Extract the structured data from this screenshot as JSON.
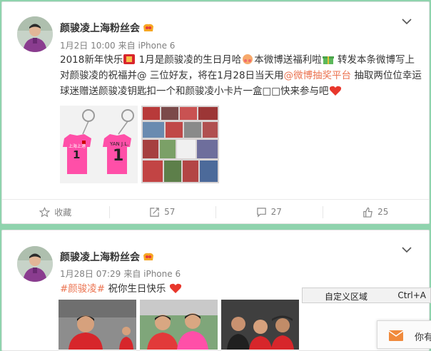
{
  "posts": [
    {
      "author": "颜骏凌上海粉丝会",
      "time": "1月2日 10:00",
      "source": "来自 iPhone 6",
      "text": {
        "p1": "2018新年快乐",
        "p2": " 1月是颜骏凌的生日月哈",
        "p3": "本微博送福利啦",
        "p4": " 转发本条微博写上对颜骏凌的祝福并@ 三位好友，将在1月28日当天用",
        "link": "@微博抽奖平台",
        "p5": " 抽取两位位幸运球迷赠送颜骏凌钥匙扣一个和颜骏凌小卡片一盒",
        "p6": "快来参与吧"
      },
      "keychain_text": {
        "jersey_name": "YAN J.L.",
        "jersey_number": "1"
      },
      "actions": {
        "favorite": "收藏",
        "repost": "57",
        "comment": "27",
        "like": "25"
      }
    },
    {
      "author": "颜骏凌上海粉丝会",
      "time": "1月28日 07:29",
      "source": "来自 iPhone 6",
      "text": {
        "hashtag": "#颜骏凌#",
        "p1": " 祝你生日快乐"
      }
    }
  ],
  "context_menu": {
    "label": "自定义区域",
    "shortcut": "Ctrl+A"
  },
  "popup": {
    "text": "你有"
  },
  "icons": [
    "avatar-photo",
    "vip-badge-icon",
    "chevron-down-icon",
    "star-icon",
    "repost-icon",
    "comment-icon",
    "like-icon",
    "heart-icon",
    "mail-icon"
  ],
  "colors": {
    "page_bg": "#8fd3ad",
    "link": "#eb7350",
    "jersey": "#ff4fa8",
    "heart": "#e8372c"
  }
}
